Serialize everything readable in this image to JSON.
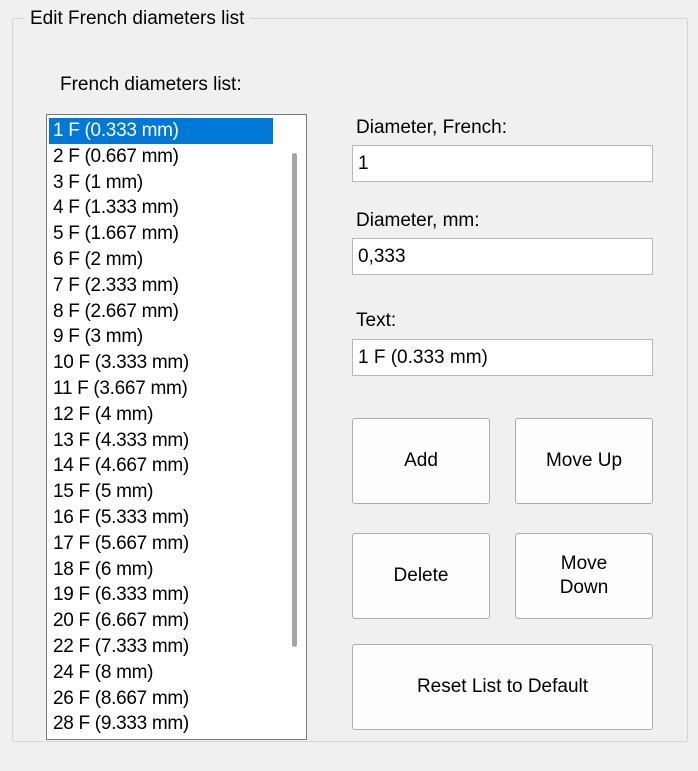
{
  "group": {
    "title": "Edit French diameters list"
  },
  "list": {
    "label": "French diameters list:",
    "items": [
      "1 F (0.333 mm)",
      "2 F (0.667 mm)",
      "3 F (1 mm)",
      "4 F (1.333 mm)",
      "5 F (1.667 mm)",
      "6 F (2 mm)",
      "7 F (2.333 mm)",
      "8 F (2.667 mm)",
      "9 F (3 mm)",
      "10 F (3.333 mm)",
      "11 F (3.667 mm)",
      "12 F (4 mm)",
      "13 F (4.333 mm)",
      "14 F (4.667 mm)",
      "15 F (5 mm)",
      "16 F (5.333 mm)",
      "17 F (5.667 mm)",
      "18 F (6 mm)",
      "19 F (6.333 mm)",
      "20 F (6.667 mm)",
      "22 F (7.333 mm)",
      "24 F (8 mm)",
      "26 F (8.667 mm)",
      "28 F (9.333 mm)"
    ],
    "selected_index": 0
  },
  "fields": {
    "diameter_french": {
      "label": "Diameter, French:",
      "value": "1"
    },
    "diameter_mm": {
      "label": "Diameter, mm:",
      "value": "0,333"
    },
    "text": {
      "label": "Text:",
      "value": "1 F (0.333 mm)"
    }
  },
  "buttons": {
    "add": "Add",
    "move_up": "Move Up",
    "delete": "Delete",
    "move_down": "Move\nDown",
    "reset": "Reset List to Default"
  },
  "colors": {
    "selection": "#0078d7",
    "background": "#f0f0f0"
  }
}
